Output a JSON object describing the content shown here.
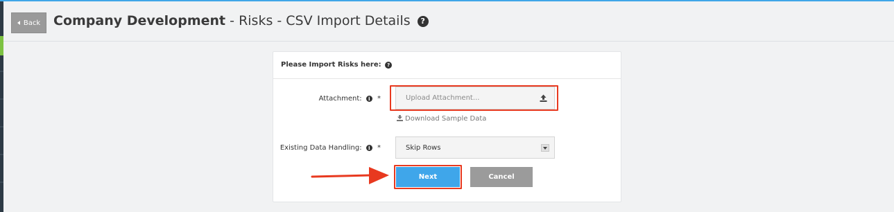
{
  "header": {
    "back_label": "Back",
    "title_strong": "Company Development",
    "title_rest": " - Risks - CSV Import Details",
    "help_glyph": "?"
  },
  "panel": {
    "heading": "Please Import Risks here:",
    "attachment": {
      "label": "Attachment:",
      "required_mark": "*",
      "info_glyph": "i",
      "placeholder": "Upload Attachment..."
    },
    "download_sample": "Download Sample Data",
    "existing_data": {
      "label": "Existing Data Handling:",
      "required_mark": "*",
      "info_glyph": "i",
      "selected": "Skip Rows"
    },
    "next_label": "Next",
    "cancel_label": "Cancel"
  },
  "colors": {
    "accent_blue": "#3fa6ea",
    "highlight_red": "#e8391f",
    "cancel_gray": "#9b9b9b"
  },
  "icons": [
    "back-triangle-icon",
    "help-icon",
    "info-icon",
    "upload-icon",
    "download-icon",
    "select-caret-icon",
    "annotation-arrow"
  ]
}
